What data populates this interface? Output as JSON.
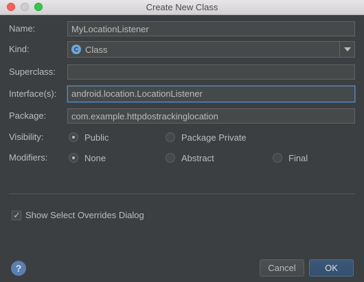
{
  "window": {
    "title": "Create New Class"
  },
  "form": {
    "name_label": "Name:",
    "name_value": "MyLocationListener",
    "kind_label": "Kind:",
    "kind_value": "Class",
    "kind_icon_letter": "C",
    "superclass_label": "Superclass:",
    "superclass_value": "",
    "interfaces_label": "Interface(s):",
    "interfaces_value": "android.location.LocationListener",
    "package_label": "Package:",
    "package_value": "com.example.httpdostrackinglocation",
    "visibility_label": "Visibility:",
    "visibility_options": [
      {
        "label": "Public",
        "selected": true
      },
      {
        "label": "Package Private",
        "selected": false
      }
    ],
    "modifiers_label": "Modifiers:",
    "modifiers_options": [
      {
        "label": "None",
        "selected": true
      },
      {
        "label": "Abstract",
        "selected": false
      },
      {
        "label": "Final",
        "selected": false
      }
    ]
  },
  "options": {
    "show_overrides_label": "Show Select Overrides Dialog",
    "show_overrides_checked": true
  },
  "footer": {
    "help_glyph": "?",
    "cancel_label": "Cancel",
    "ok_label": "OK"
  },
  "colors": {
    "background": "#3c3f41",
    "field_bg": "#45494a",
    "focus_border": "#5b87b3",
    "ok_button": "#365880"
  }
}
